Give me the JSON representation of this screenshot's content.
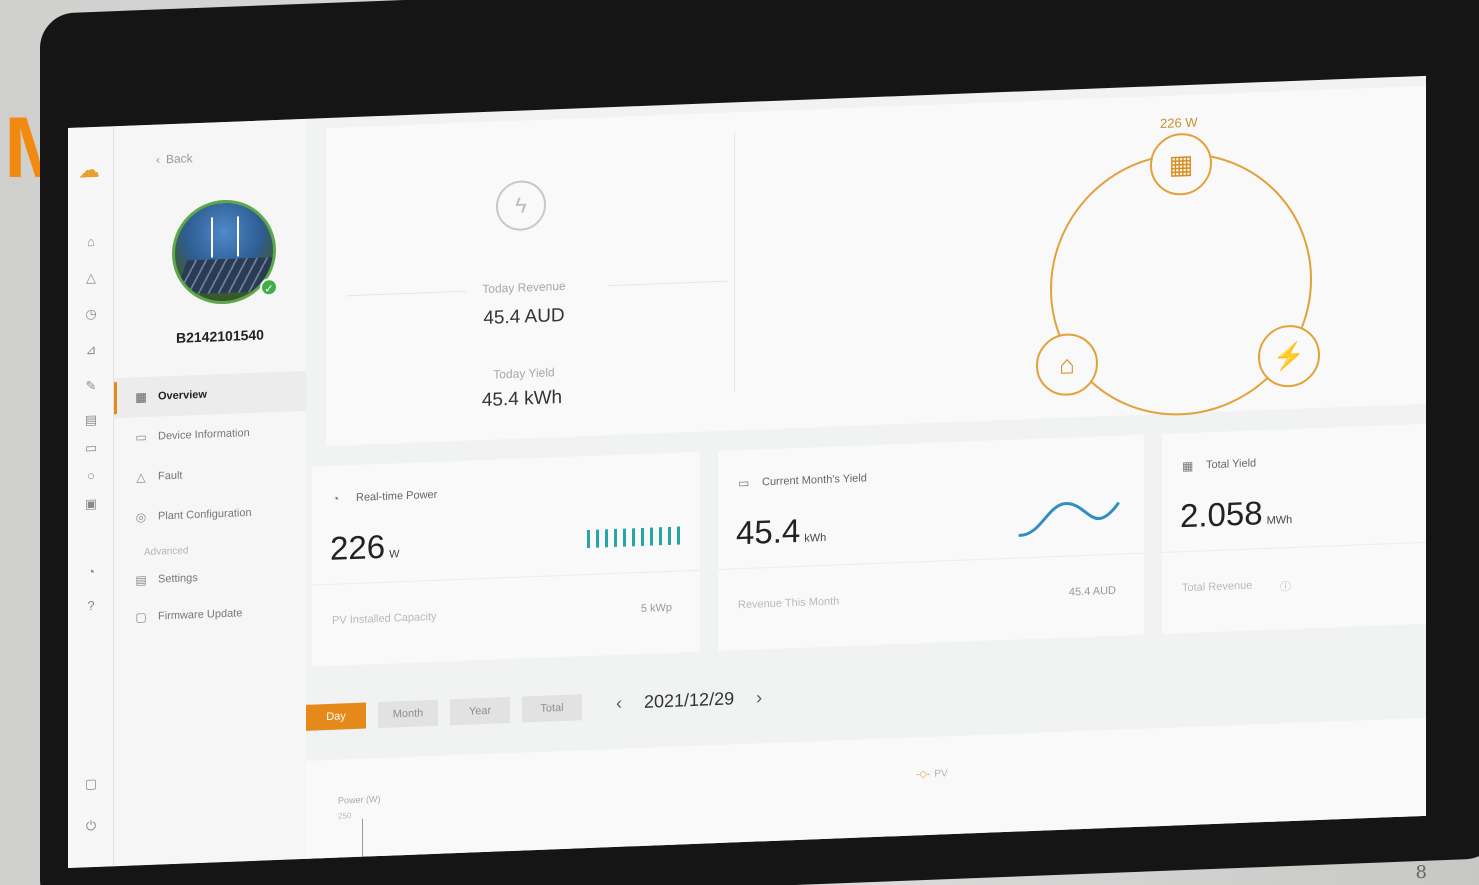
{
  "brand_mark": "M",
  "sidebar": {
    "back_label": "Back",
    "device_sn": "B2142101540",
    "menu": [
      {
        "label": "Overview",
        "icon": "grid-icon",
        "active": true
      },
      {
        "label": "Device Information",
        "icon": "calendar-icon",
        "active": false
      },
      {
        "label": "Fault",
        "icon": "warning-icon",
        "active": false
      },
      {
        "label": "Plant Configuration",
        "icon": "gear-icon",
        "active": false
      }
    ],
    "advanced_label": "Advanced",
    "advanced_menu": [
      {
        "label": "Settings",
        "icon": "settings-icon"
      },
      {
        "label": "Firmware Update",
        "icon": "firmware-icon"
      }
    ]
  },
  "summary": {
    "today_revenue_label": "Today Revenue",
    "today_revenue_value": "45.4 AUD",
    "today_yield_label": "Today Yield",
    "today_yield_value": "45.4 kWh"
  },
  "flow": {
    "pv_power": "226 W",
    "nodes": [
      "solar-panel-icon",
      "home-icon",
      "grid-tower-icon"
    ]
  },
  "kpis": {
    "realtime_power": {
      "label": "Real-time Power",
      "value": "226",
      "unit": "W",
      "footer_label": "PV Installed Capacity",
      "footer_value": "5 kWp"
    },
    "current_month_yield": {
      "label": "Current Month's Yield",
      "value": "45.4",
      "unit": "kWh",
      "footer_label": "Revenue This Month",
      "footer_value": "45.4 AUD"
    },
    "total_yield": {
      "label": "Total Yield",
      "value": "2.058",
      "unit": "MWh",
      "footer_label": "Total Revenue"
    }
  },
  "period_tabs": [
    "Day",
    "Month",
    "Year",
    "Total"
  ],
  "active_period": "Day",
  "date": "2021/12/29",
  "chart": {
    "ylabel": "Power (W)",
    "ytick": "250",
    "legend": "PV"
  },
  "colors": {
    "accent": "#e58a1a",
    "flow": "#e3a13a",
    "teal": "#27a6a8",
    "online": "#3fae49"
  },
  "photo_corner_text": "8"
}
